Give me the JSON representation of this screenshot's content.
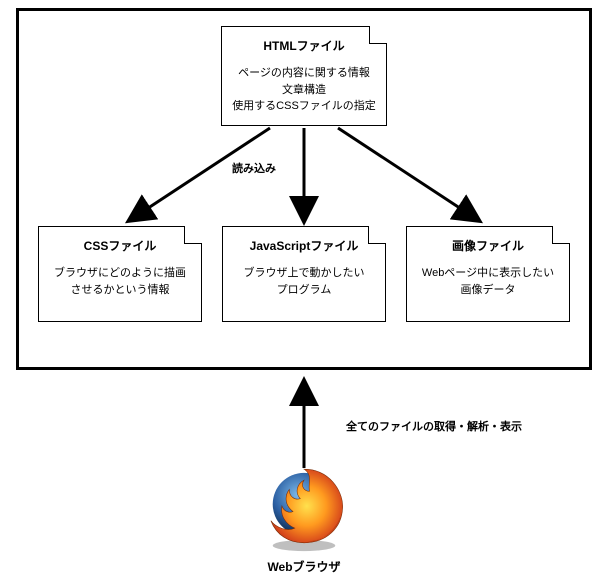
{
  "outer_label": "",
  "files": {
    "html": {
      "title": "HTMLファイル",
      "body": "ページの内容に関する情報\n文章構造\n使用するCSSファイルの指定"
    },
    "css": {
      "title": "CSSファイル",
      "body": "ブラウザにどのように描画\nさせるかという情報"
    },
    "js": {
      "title": "JavaScriptファイル",
      "body": "ブラウザ上で動かしたい\nプログラム"
    },
    "img": {
      "title": "画像ファイル",
      "body": "Webページ中に表示したい\n画像データ"
    }
  },
  "edges": {
    "load": "読み込み",
    "fetch": "全てのファイルの取得・解析・表示"
  },
  "browser": {
    "label": "Webブラウザ",
    "icon": "firefox-icon"
  }
}
